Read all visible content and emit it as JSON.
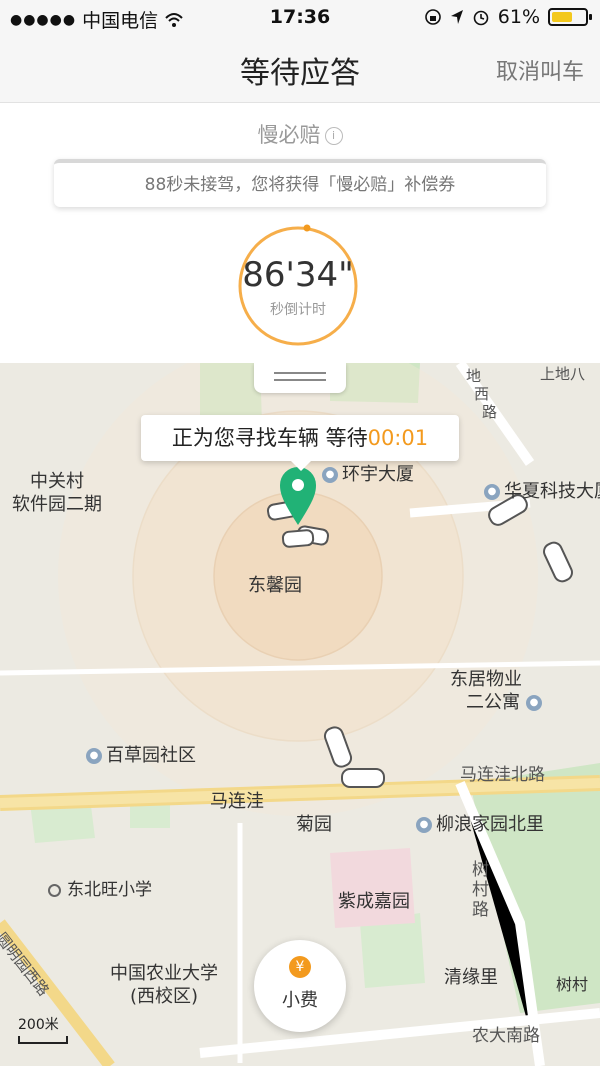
{
  "status_bar": {
    "signal": "●●●●●",
    "carrier": "中国电信",
    "wifi_icon": "wifi-icon",
    "time": "17:36",
    "battery_percent": "61%",
    "battery_level": 0.61
  },
  "header": {
    "title": "等待应答",
    "cancel_label": "取消叫车"
  },
  "compensation": {
    "title": "慢必赔",
    "info_symbol": "i",
    "notice": "88秒未接驾，您将获得「慢必赔」补偿券",
    "timer_value": "86'34\"",
    "timer_label": "秒倒计时"
  },
  "map": {
    "search_prefix": "正为您寻找车辆 等待",
    "search_count": "00:01",
    "places": {
      "zhongguancun_1": "中关村",
      "zhongguancun_2": "软件园二期",
      "huanyu": "环宇大厦",
      "huaxia": "华夏科技大厦",
      "dongxin": "东馨园",
      "dongju_1": "东居物业",
      "dongju_2": "二公寓",
      "baicao": "百草园社区",
      "malianwa": "马连洼",
      "malianwa_north": "马连洼北路",
      "juyuan": "菊园",
      "liulang": "柳浪家园北里",
      "shucun_1": "树",
      "shucun_2": "村",
      "shucun_3": "路",
      "dongbeiwang": "东北旺小学",
      "zicheng": "紫成嘉园",
      "cau_1": "中国农业大学",
      "cau_2": "(西校区)",
      "qingyuan": "清缘里",
      "nongda": "农大南路",
      "yuanmingyuan": "圆明园西路",
      "dixi_1": "地",
      "dixi_2": "西",
      "dixi_3": "路",
      "shangdi": "上地八",
      "shucun_edge": "树村"
    },
    "tip_label": "小费",
    "tip_symbol": "¥",
    "scale": "200米"
  },
  "colors": {
    "accent": "#f39a1e",
    "pin": "#21b276",
    "park": "#cfe6c5"
  }
}
